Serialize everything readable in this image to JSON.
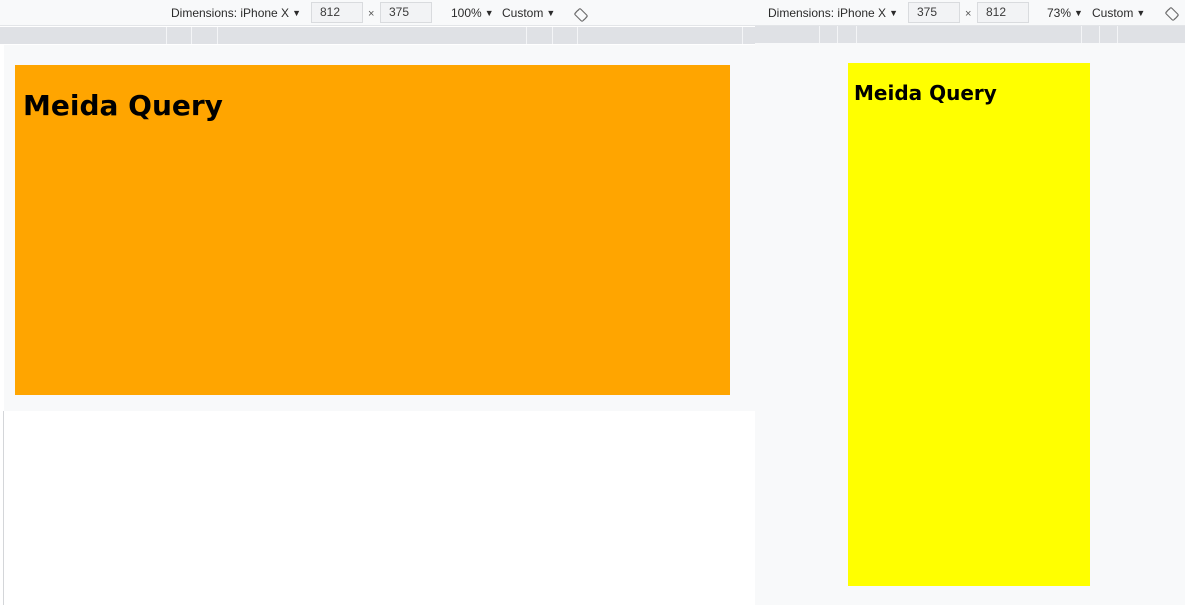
{
  "left_panel": {
    "toolbar": {
      "dimensions_label": "Dimensions: iPhone X",
      "width_value": "812",
      "times": "×",
      "height_value": "375",
      "zoom": "100%",
      "throttle": "Custom",
      "caret": "▼",
      "rotate_icon": "rotate-icon"
    },
    "content": {
      "heading": "Meida Query",
      "background_color": "#ffa500"
    }
  },
  "right_panel": {
    "toolbar": {
      "dimensions_label": "Dimensions: iPhone X",
      "width_value": "375",
      "times": "×",
      "height_value": "812",
      "zoom": "73%",
      "throttle": "Custom",
      "caret": "▼",
      "rotate_icon": "rotate-icon"
    },
    "content": {
      "heading": "Meida Query",
      "background_color": "#ffff00"
    }
  }
}
